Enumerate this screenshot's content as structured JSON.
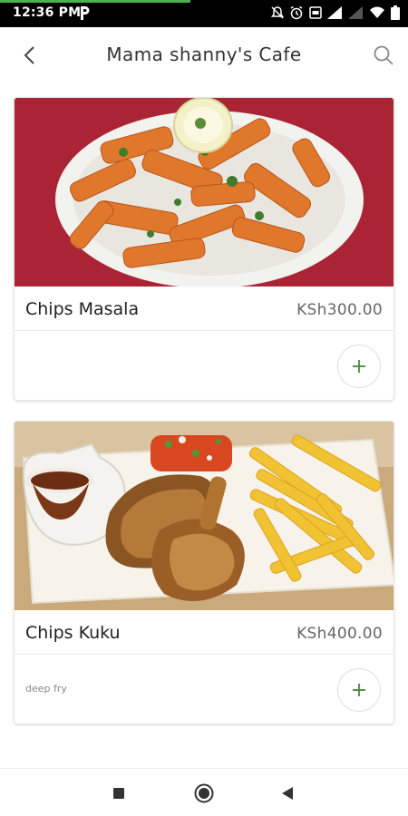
{
  "status_bar": {
    "time": "12:36 PM",
    "icons": [
      "p-app-icon",
      "mute-icon",
      "alarm-icon",
      "message-icon",
      "signal-icon",
      "signal-icon",
      "wifi-icon",
      "battery-icon"
    ]
  },
  "header": {
    "title": "Mama shanny's Cafe",
    "back_icon": "back-arrow-icon",
    "search_icon": "search-icon"
  },
  "menu_items": [
    {
      "name": "Chips Masala",
      "price": "KSh300.00",
      "description": "",
      "add_label": "+",
      "image": "chips-masala-photo"
    },
    {
      "name": "Chips Kuku",
      "price": "KSh400.00",
      "description": "deep fry",
      "add_label": "+",
      "image": "chips-kuku-photo"
    }
  ],
  "nav_bar": {
    "icons": [
      "recents-square-icon",
      "home-circle-icon",
      "back-triangle-icon"
    ]
  },
  "colors": {
    "accent": "#4c8a3f",
    "status_bar": "#000000",
    "background": "#ffffff"
  }
}
